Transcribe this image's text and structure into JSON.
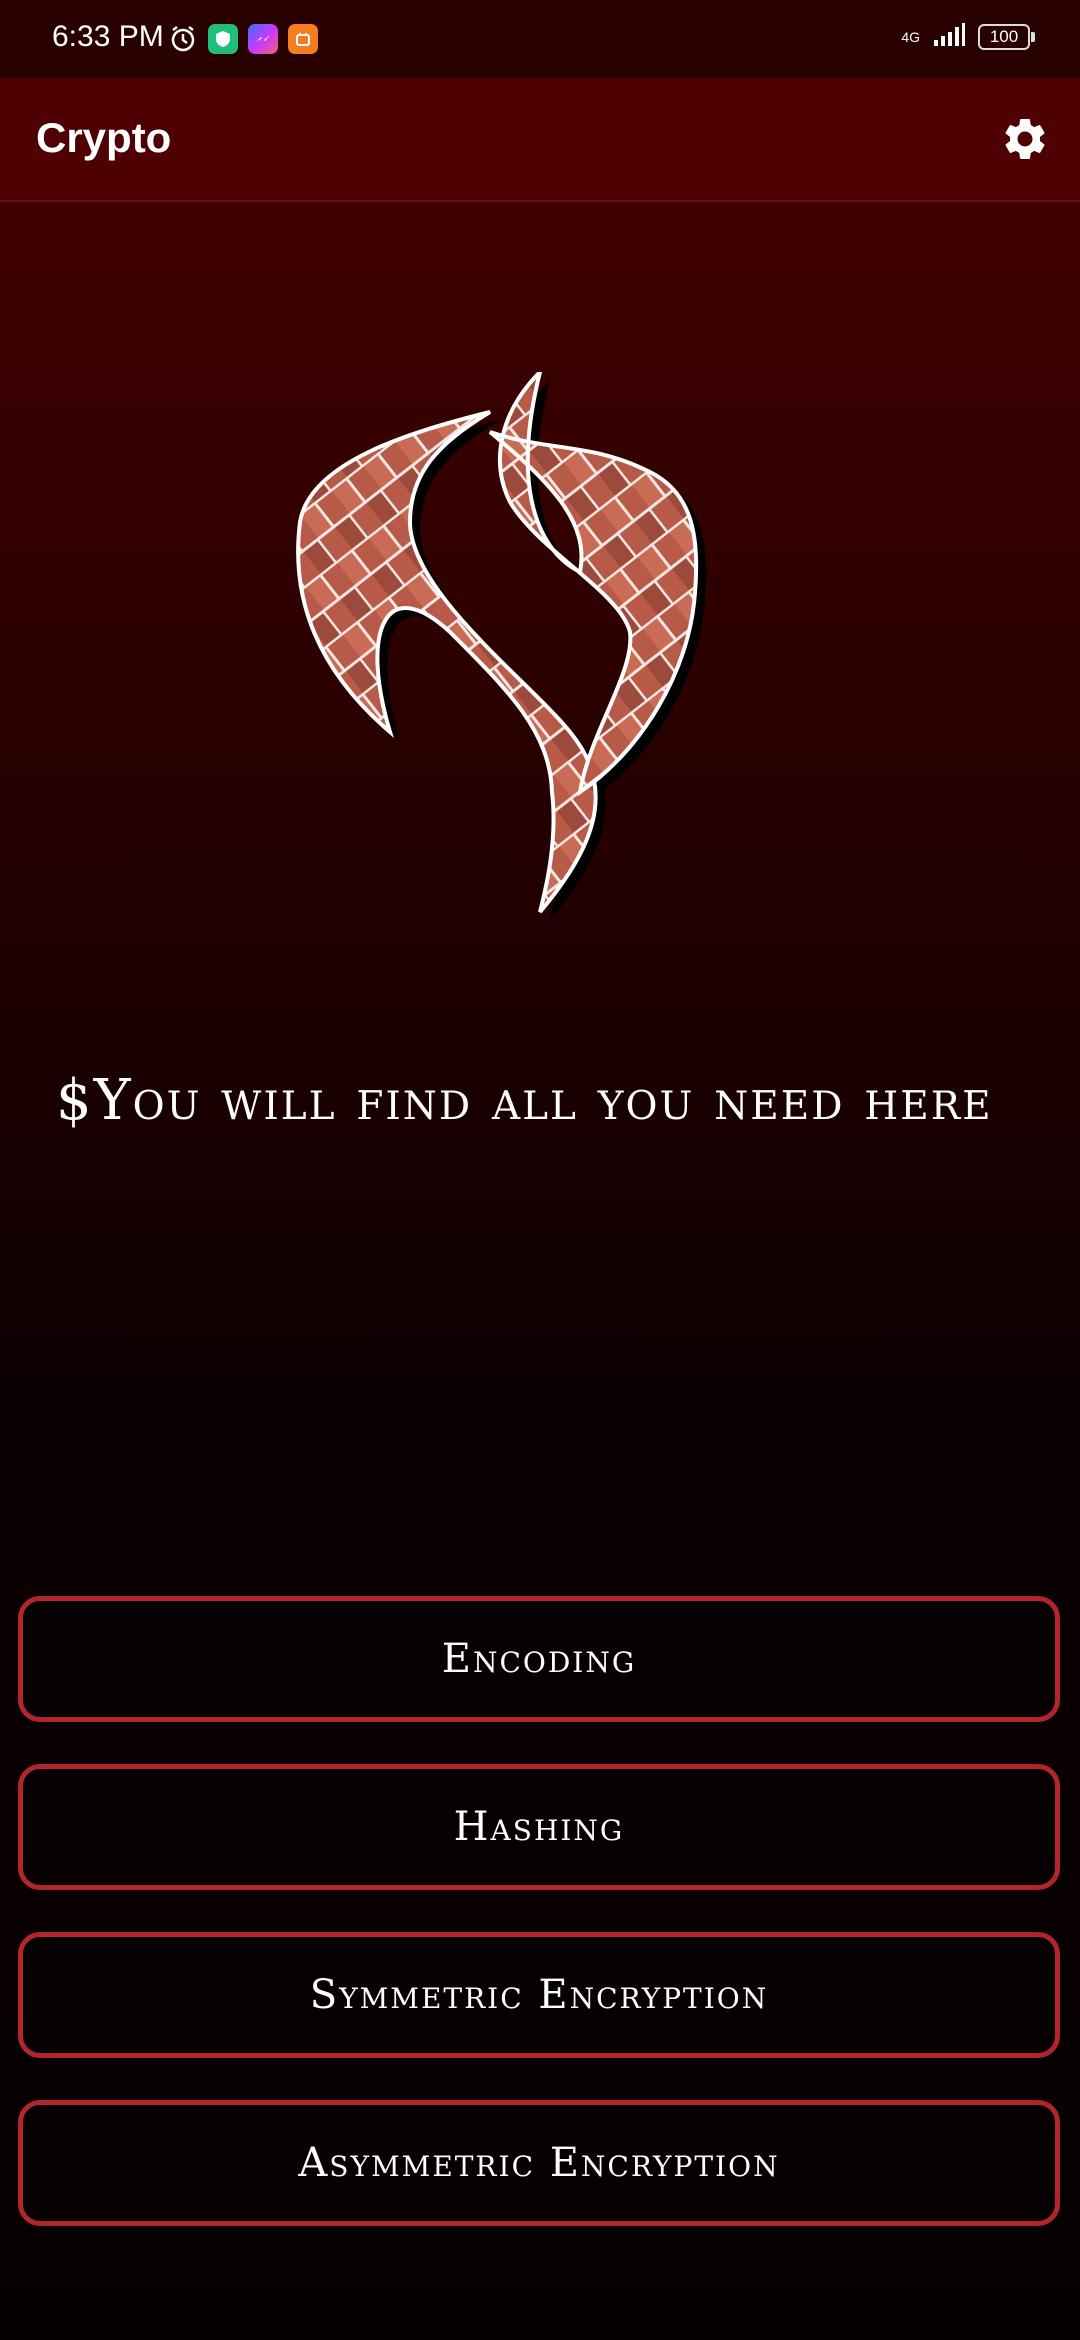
{
  "status_bar": {
    "time": "6:33 PM",
    "network": "4G",
    "battery": "100",
    "icons": [
      "alarm-icon",
      "shield-app-icon",
      "messenger-icon",
      "orange-app-icon",
      "signal-icon",
      "battery-icon"
    ]
  },
  "app_bar": {
    "title": "Crypto",
    "settings_icon": "gear-icon"
  },
  "main": {
    "tagline": "$You will find all you need here",
    "buttons": [
      {
        "label": "Encoding"
      },
      {
        "label": "Hashing"
      },
      {
        "label": "Symmetric Encryption"
      },
      {
        "label": "Asymmetric Encryption"
      }
    ]
  },
  "colors": {
    "app_bar": "#4e0003",
    "button_border": "#b0262a",
    "logo_brick": "#b5594a"
  }
}
